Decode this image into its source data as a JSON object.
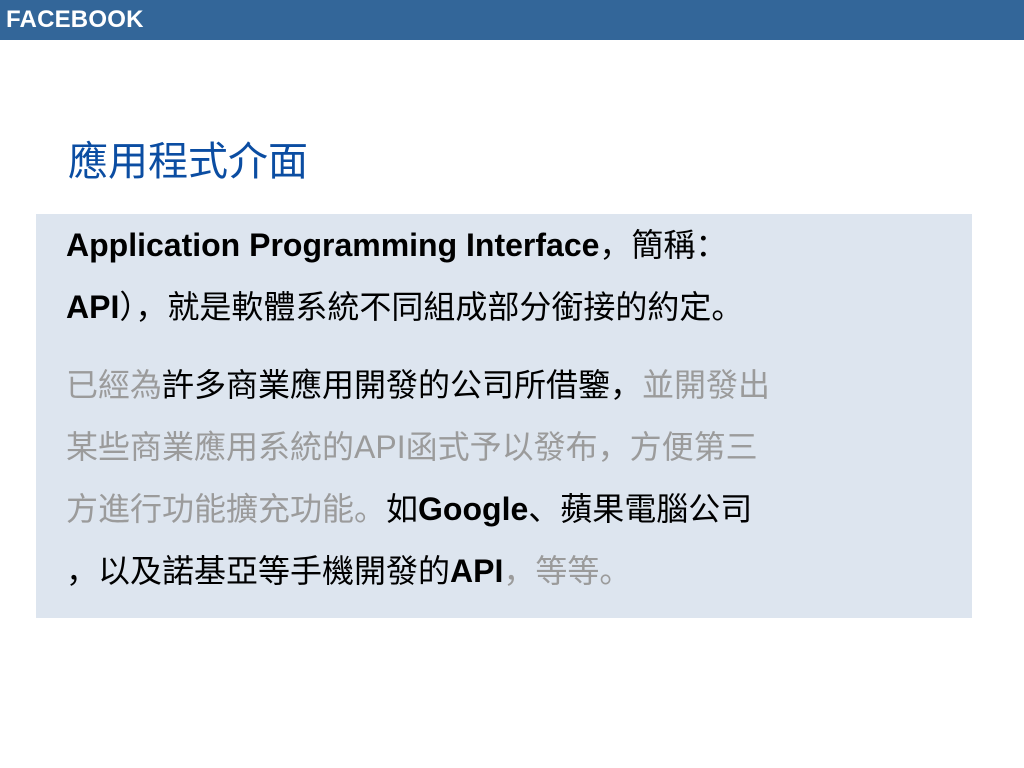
{
  "header": {
    "label": "FACEBOOK"
  },
  "slide": {
    "title": "應用程式介面",
    "paragraph1": {
      "line1_en": "Application Programming Interface",
      "line1_zh": "，簡稱：",
      "line2_en": "API",
      "line2_zh": "），就是軟體系統不同組成部分銜接的約定。"
    },
    "paragraph2": {
      "l1_gray_a": "已經為",
      "l1_black": "許多商業應用開發的公司所借鑒，",
      "l1_gray_b": "並開發出",
      "l2_gray_a": "某些商業應用系統的",
      "l2_gray_api": "API",
      "l2_gray_b": "函式予以發布，方便第三",
      "l3_gray": "方進行功能擴充功能。",
      "l3_black_a": "如",
      "l3_black_google": "Google",
      "l3_black_b": "、蘋果電腦公司",
      "l4_black_a": "，以及諾基亞等手機開發的",
      "l4_black_api": "API",
      "l4_gray": "，等等。"
    }
  },
  "colors": {
    "header_bg": "#336699",
    "title": "#0b4da2",
    "box_bg": "#dde5ef",
    "muted_text": "#9b9b9b"
  }
}
